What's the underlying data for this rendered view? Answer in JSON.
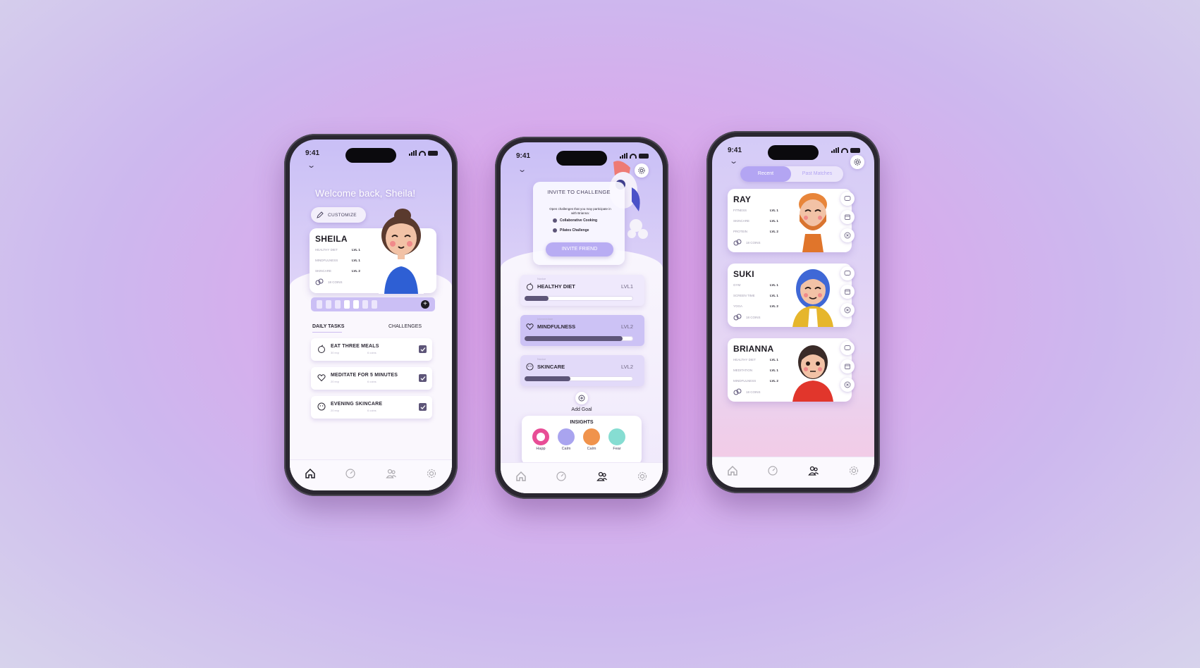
{
  "status_time": "9:41",
  "phone1": {
    "welcome": "Welcome back, Sheila!",
    "customize": "CUSTOMIZE",
    "profile": {
      "name": "SHEILA",
      "stats": [
        {
          "label": "HEALTHY DIET",
          "level": "LVL 1"
        },
        {
          "label": "MINDFULNESS",
          "level": "LVL 1"
        },
        {
          "label": "SKINCARE",
          "level": "LVL 2"
        }
      ],
      "coins": "18 COINS"
    },
    "progress_filled_segments": 6,
    "tabs": {
      "daily": "DAILY TASKS",
      "challenges": "CHALLENGES"
    },
    "tasks": [
      {
        "title": "EAT THREE MEALS",
        "exp": "30 exp",
        "coins": "6 coins",
        "icon": "apple-icon"
      },
      {
        "title": "MEDITATE FOR 5 MINUTES",
        "exp": "20 exp",
        "coins": "6 coins",
        "icon": "heart-icon"
      },
      {
        "title": "EVENING SKINCARE",
        "exp": "20 exp",
        "coins": "6 coins",
        "icon": "face-icon"
      }
    ]
  },
  "phone2": {
    "invite": {
      "title": "INVITE TO CHALLENGE",
      "desc": "Open challenges that you may participate in with Brianna:",
      "options": [
        "Collaborative Cooking",
        "Pilates Challenge"
      ],
      "button": "INVITE FRIEND"
    },
    "goals": [
      {
        "tier": "Novice",
        "name": "HEALTHY DIET",
        "level": "LVL1",
        "progress": 0.22,
        "icon": "apple-icon"
      },
      {
        "tier": "Intermediate",
        "name": "MINDFULNESS",
        "level": "LVL2",
        "progress": 0.9,
        "icon": "heart-icon"
      },
      {
        "tier": "Novice",
        "name": "SKINCARE",
        "level": "LVL2",
        "progress": 0.42,
        "icon": "face-icon"
      }
    ],
    "add_goal": "Add Goal",
    "insights": {
      "title": "INSIGHTS",
      "moods": [
        {
          "label": "Happ",
          "color": "#e84d96"
        },
        {
          "label": "Calm",
          "color": "#a9a4ef"
        },
        {
          "label": "Calm",
          "color": "#f0934c"
        },
        {
          "label": "Fear",
          "color": "#86ddd2"
        }
      ]
    }
  },
  "phone3": {
    "segments": {
      "recent": "Recent",
      "past": "Past Matches"
    },
    "friends": [
      {
        "name": "RAY",
        "stats": [
          {
            "label": "FITNESS",
            "level": "LVL 1"
          },
          {
            "label": "SKINCARE",
            "level": "LVL 1"
          },
          {
            "label": "PROTEIN",
            "level": "LVL 2"
          }
        ],
        "coins": "18 COINS"
      },
      {
        "name": "SUKI",
        "stats": [
          {
            "label": "GYM",
            "level": "LVL 1"
          },
          {
            "label": "SCREEN TIME",
            "level": "LVL 1"
          },
          {
            "label": "YOGA",
            "level": "LVL 2"
          }
        ],
        "coins": "18 COINS"
      },
      {
        "name": "BRIANNA",
        "stats": [
          {
            "label": "HEALTHY DIET",
            "level": "LVL 1"
          },
          {
            "label": "MEDITATION",
            "level": "LVL 1"
          },
          {
            "label": "MINDFULNESS",
            "level": "LVL 2"
          }
        ],
        "coins": "18 COINS"
      }
    ]
  }
}
